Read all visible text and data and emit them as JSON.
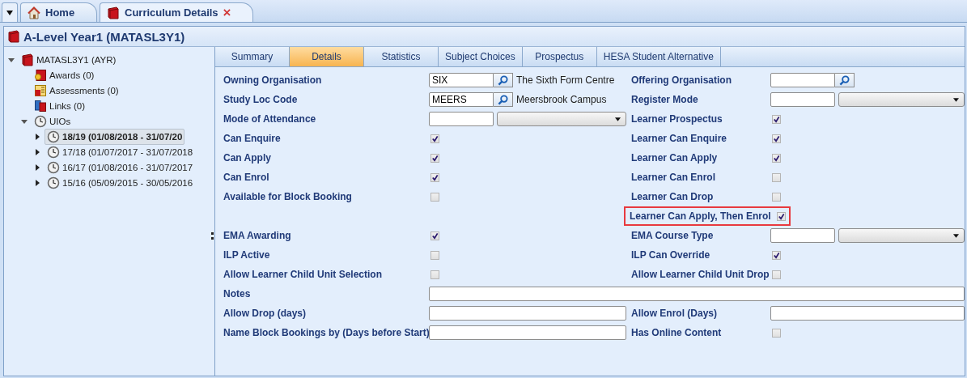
{
  "doc_tabs": [
    {
      "label": "Home",
      "kind": "home",
      "selected": false,
      "closable": false
    },
    {
      "label": "Curriculum Details",
      "kind": "book",
      "selected": true,
      "closable": true
    }
  ],
  "close_glyph": "×",
  "title": "A-Level Year1 (MATASL3Y1)",
  "tree": [
    {
      "label": "MATASL3Y1 (AYR)",
      "kind": "book",
      "expanded": true,
      "selected": false,
      "children": [
        {
          "label": "Awards (0)",
          "kind": "award",
          "selected": false
        },
        {
          "label": "Assessments (0)",
          "kind": "assessment",
          "selected": false
        },
        {
          "label": "Links (0)",
          "kind": "links",
          "selected": false
        },
        {
          "label": "UIOs",
          "kind": "clock",
          "expanded": true,
          "selected": false,
          "children": [
            {
              "label": "18/19 (01/08/2018 - 31/07/20",
              "kind": "clock",
              "expanded": false,
              "selected": true
            },
            {
              "label": "17/18 (01/07/2017 - 31/07/2018",
              "kind": "clock",
              "expanded": false,
              "selected": false
            },
            {
              "label": "16/17 (01/08/2016 - 31/07/2017",
              "kind": "clock",
              "expanded": false,
              "selected": false
            },
            {
              "label": "15/16 (05/09/2015 - 30/05/2016",
              "kind": "clock",
              "expanded": false,
              "selected": false
            }
          ]
        }
      ]
    }
  ],
  "detail_tabs": [
    {
      "label": "Summary",
      "selected": false
    },
    {
      "label": "Details",
      "selected": true
    },
    {
      "label": "Statistics",
      "selected": false
    },
    {
      "label": "Subject Choices",
      "selected": false
    },
    {
      "label": "Prospectus",
      "selected": false
    },
    {
      "label": "HESA Student Alternative",
      "selected": false
    }
  ],
  "form": {
    "rows": [
      {
        "left": {
          "label": "Owning Organisation",
          "kind": "lookup",
          "value": "SIX",
          "description": "The Sixth Form Centre"
        },
        "right": {
          "label": "Offering Organisation",
          "kind": "lookup"
        }
      },
      {
        "left": {
          "label": "Study Loc Code",
          "kind": "lookup",
          "value": "MEERS",
          "description": "Meersbrook Campus"
        },
        "right": {
          "label": "Register Mode",
          "kind": "code_dropdown"
        }
      },
      {
        "left": {
          "label": "Mode of Attendance",
          "kind": "code_dropdown"
        },
        "right": {
          "label": "Learner Prospectus",
          "kind": "checkbox",
          "checked": true
        }
      },
      {
        "left": {
          "label": "Can Enquire",
          "kind": "checkbox",
          "checked": true
        },
        "right": {
          "label": "Learner Can Enquire",
          "kind": "checkbox",
          "checked": true
        }
      },
      {
        "left": {
          "label": "Can Apply",
          "kind": "checkbox",
          "checked": true
        },
        "right": {
          "label": "Learner Can Apply",
          "kind": "checkbox",
          "checked": true
        }
      },
      {
        "left": {
          "label": "Can Enrol",
          "kind": "checkbox",
          "checked": true
        },
        "right": {
          "label": "Learner Can Enrol",
          "kind": "checkbox",
          "checked": false
        }
      },
      {
        "left": {
          "label": "Available for Block Booking",
          "kind": "checkbox",
          "checked": false
        },
        "right": {
          "label": "Learner Can Drop",
          "kind": "checkbox",
          "checked": false
        }
      },
      {
        "right": {
          "label": "Learner Can Apply, Then Enrol",
          "kind": "checkbox",
          "checked": true,
          "highlighted": true
        }
      },
      {
        "left": {
          "label": "EMA Awarding",
          "kind": "checkbox",
          "checked": true
        },
        "right": {
          "label": "EMA Course Type",
          "kind": "code_dropdown"
        }
      },
      {
        "left": {
          "label": "ILP Active",
          "kind": "checkbox",
          "checked": false
        },
        "right": {
          "label": "ILP Can Override",
          "kind": "checkbox",
          "checked": true
        }
      },
      {
        "left": {
          "label": "Allow Learner Child Unit Selection",
          "kind": "checkbox",
          "checked": false
        },
        "right": {
          "label": "Allow Learner Child Unit Drop",
          "kind": "checkbox",
          "checked": false
        }
      },
      {
        "wide": {
          "label": "Notes",
          "kind": "text"
        }
      },
      {
        "left": {
          "label": "Allow Drop (days)",
          "kind": "text"
        },
        "right": {
          "label": "Allow Enrol (Days)",
          "kind": "text"
        }
      },
      {
        "left": {
          "label": "Name Block Bookings by (Days before Start)",
          "kind": "text"
        },
        "right": {
          "label": "Has Online Content",
          "kind": "checkbox",
          "checked": false
        }
      }
    ]
  }
}
